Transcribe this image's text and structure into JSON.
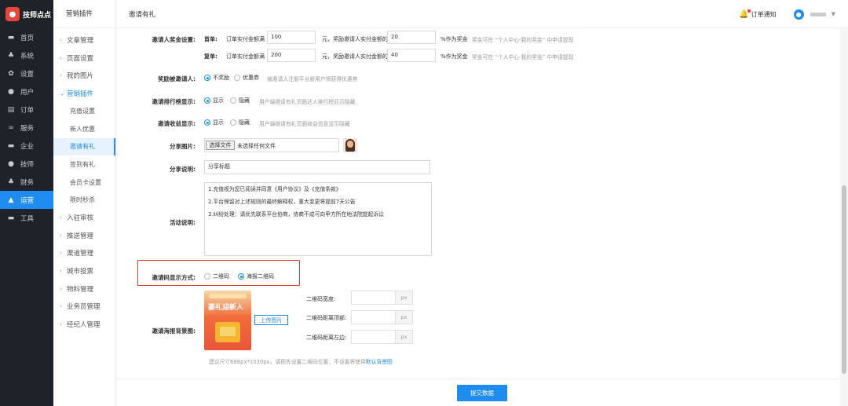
{
  "brand": {
    "logo_glyph": "●",
    "name": "技师点点"
  },
  "left_nav": [
    {
      "icon": "monitor-icon",
      "glyph": "▬",
      "label": "首页",
      "active": false
    },
    {
      "icon": "sitemap-icon",
      "glyph": "♣",
      "label": "系统",
      "active": false
    },
    {
      "icon": "gear-icon",
      "glyph": "✿",
      "label": "设置",
      "active": false
    },
    {
      "icon": "user-icon",
      "glyph": "●",
      "label": "用户",
      "active": false
    },
    {
      "icon": "order-icon",
      "glyph": "▤",
      "label": "订单",
      "active": false
    },
    {
      "icon": "link-icon",
      "glyph": "∞",
      "label": "服务",
      "active": false
    },
    {
      "icon": "building-icon",
      "glyph": "▬",
      "label": "企业",
      "active": false
    },
    {
      "icon": "technician-icon",
      "glyph": "●",
      "label": "技师",
      "active": false
    },
    {
      "icon": "finance-icon",
      "glyph": "♣",
      "label": "财务",
      "active": false
    },
    {
      "icon": "chart-icon",
      "glyph": "▲",
      "label": "运营",
      "active": true
    },
    {
      "icon": "briefcase-icon",
      "glyph": "▬",
      "label": "工具",
      "active": false
    }
  ],
  "sub_nav": {
    "title": "营销插件",
    "items": [
      {
        "label": "文章管理",
        "arrow": "›"
      },
      {
        "label": "页面设置",
        "arrow": "›"
      },
      {
        "label": "我的图片",
        "arrow": "›"
      },
      {
        "label": "营销插件",
        "arrow": "⌄",
        "open": true
      }
    ],
    "sub_items": [
      "充值设置",
      "新人优惠",
      "邀请有礼",
      "签到有礼",
      "会员卡设置",
      "限时秒杀"
    ],
    "selected_sub": "邀请有礼",
    "more_items": [
      "入驻审核",
      "推送管理",
      "渠道管理",
      "城市投票",
      "物料管理",
      "业务员管理",
      "经纪人管理"
    ]
  },
  "topbar": {
    "page_title": "邀请有礼",
    "notify_label": "订单通知",
    "avatar_glyph": "●",
    "caret": "▼"
  },
  "form": {
    "reward_label": "邀请人奖金设置:",
    "first_order": {
      "tag": "首单:",
      "pre": "订单实付金额满",
      "amount": "100",
      "mid": "元，奖励邀请人实付金额的",
      "percent": "20",
      "suffix": "%作为奖金",
      "hint": "奖金可在 “个人中心-我的奖金” 中申请提现"
    },
    "repeat_order": {
      "tag": "复单:",
      "pre": "订单实付金额满",
      "amount": "200",
      "mid": "元，奖励邀请人实付金额的",
      "percent": "40",
      "suffix": "%作为奖金",
      "hint": "奖金可在 “个人中心-我的奖金” 中申请提现"
    },
    "invitee_reward": {
      "label": "奖励被邀请人:",
      "options": [
        "不奖励",
        "优惠券"
      ],
      "selected": 0,
      "hint": "被邀请人注册平台新用户将获得优惠券"
    },
    "ranking_display": {
      "label": "邀请排行榜显示:",
      "options": [
        "显示",
        "隐藏"
      ],
      "selected": 0,
      "hint": "用户端邀请有礼页面达人排行榜显示隐藏"
    },
    "income_display": {
      "label": "邀请收益显示:",
      "options": [
        "显示",
        "隐藏"
      ],
      "selected": 0,
      "hint": "用户端邀请有礼页面收益信息显示隐藏"
    },
    "share_image": {
      "label": "分享图片:",
      "button": "选择文件",
      "status": "未选择任何文件"
    },
    "share_desc": {
      "label": "分享说明:",
      "value": "分享标题"
    },
    "activity_desc": {
      "label": "活动说明:",
      "lines": [
        "1.充值视为您已阅读并同意《用户协议》及《充值条款》",
        "2.平台保留对上述规则的最终解释权，重大变更将提前7天公告",
        "3.纠纷处理：请优先联系平台协商，协商不成可向甲方所在地法院提起诉讼"
      ]
    },
    "qr_mode": {
      "label": "邀请码显示方式:",
      "options": [
        "二维码",
        "海报二维码"
      ],
      "selected": 1
    },
    "poster": {
      "label": "邀请海报背景图:",
      "poster_title": "豪礼迎新人",
      "upload_button": "上传图片",
      "fields": [
        {
          "label": "二维码宽度:",
          "suffix": "px"
        },
        {
          "label": "二维码距离顶部:",
          "suffix": "px"
        },
        {
          "label": "二维码距离左边:",
          "suffix": "px"
        }
      ],
      "hint_prefix": "建议尺寸686px*1030px，请预先设置二维码位置；不设置将使用",
      "hint_link": "默认背景图"
    }
  },
  "submit_label": "提交数据",
  "colors": {
    "accent": "#1e8cf0",
    "highlight": "#e0392e",
    "sidebar": "#20222a"
  }
}
